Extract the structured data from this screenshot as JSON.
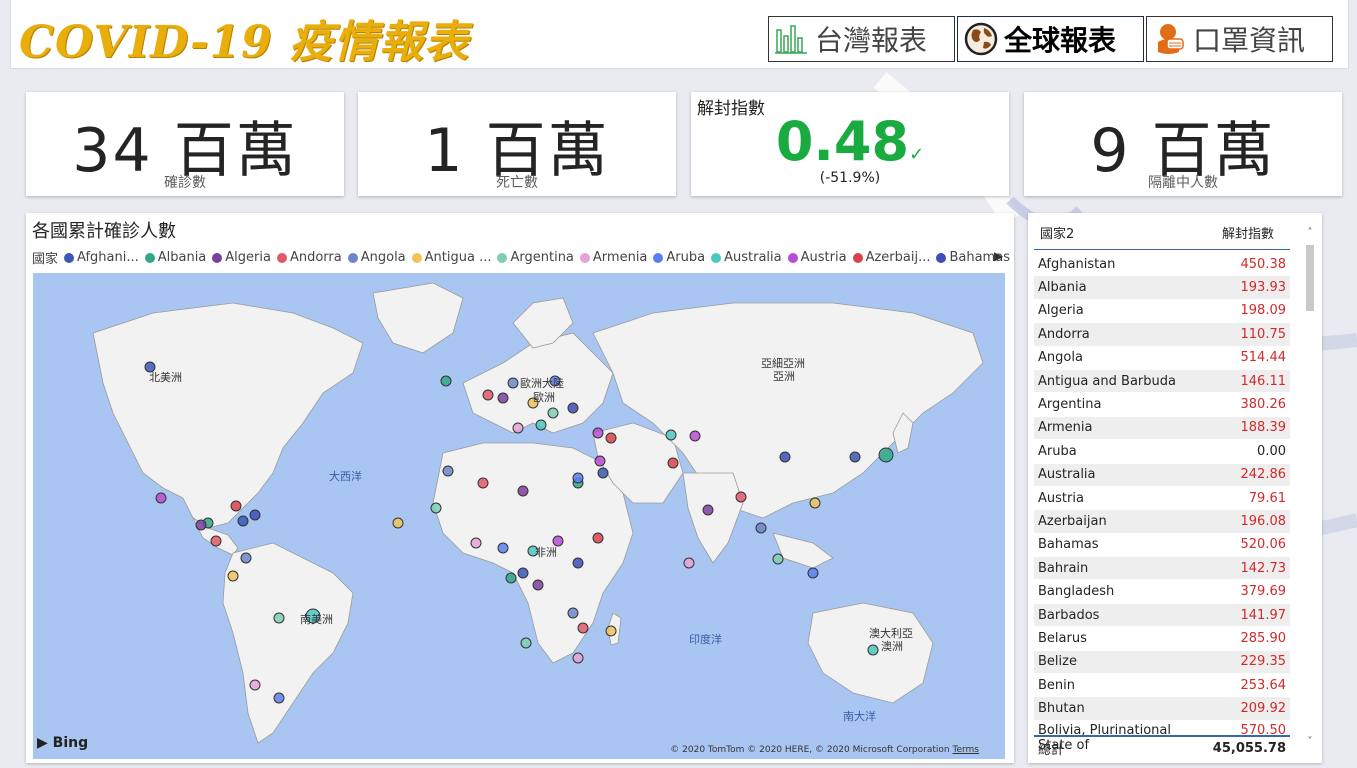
{
  "header": {
    "title": "COVID-19 疫情報表",
    "nav": [
      {
        "label": "台灣報表",
        "icon": "bar-chart-icon",
        "active": false
      },
      {
        "label": "全球報表",
        "icon": "globe-icon",
        "active": true
      },
      {
        "label": "口罩資訊",
        "icon": "mask-icon",
        "active": false
      }
    ]
  },
  "cards": {
    "confirmed": {
      "value": "34 百萬",
      "caption": "確診數"
    },
    "deaths": {
      "value": "1 百萬",
      "caption": "死亡數"
    },
    "reopen": {
      "title": "解封指數",
      "value": "0.48",
      "check": "✓",
      "sub": "(-51.9%)"
    },
    "quarantine": {
      "value": "9 百萬",
      "caption": "隔離中人數"
    }
  },
  "map_panel": {
    "title": "各國累計確診人數",
    "legend_label": "國家",
    "legend": [
      {
        "name": "Afghani...",
        "color": "#3a58b5"
      },
      {
        "name": "Albania",
        "color": "#2fa889"
      },
      {
        "name": "Algeria",
        "color": "#7b3fa0"
      },
      {
        "name": "Andorra",
        "color": "#e0596b"
      },
      {
        "name": "Angola",
        "color": "#6b86c9"
      },
      {
        "name": "Antigua ...",
        "color": "#f0c35a"
      },
      {
        "name": "Argentina",
        "color": "#7fcfb0"
      },
      {
        "name": "Armenia",
        "color": "#e5a3d6"
      },
      {
        "name": "Aruba",
        "color": "#5c7ff0"
      },
      {
        "name": "Australia",
        "color": "#4cc7c0"
      },
      {
        "name": "Austria",
        "color": "#b84cd4"
      },
      {
        "name": "Azerbaij...",
        "color": "#d8434a"
      },
      {
        "name": "Bahamas",
        "color": "#3d4cb8"
      }
    ],
    "regions": {
      "north_america": "北美洲",
      "south_america": "南美洲",
      "europe_1": "歐洲大陸",
      "europe_2": "歐洲",
      "africa": "非洲",
      "asia_1": "亞細亞洲",
      "asia_2": "亞洲",
      "oceania_1": "澳大利亞",
      "oceania_2": "澳洲",
      "atlantic": "大西洋",
      "indian": "印度洋",
      "south_sea": "南大洋"
    },
    "bing": "Bing",
    "copyright": "© 2020 TomTom © 2020 HERE, © 2020 Microsoft Corporation",
    "terms": "Terms"
  },
  "table": {
    "col_country": "國家2",
    "col_index": "解封指數",
    "rows": [
      {
        "country": "Afghanistan",
        "value": "450.38"
      },
      {
        "country": "Albania",
        "value": "193.93"
      },
      {
        "country": "Algeria",
        "value": "198.09"
      },
      {
        "country": "Andorra",
        "value": "110.75"
      },
      {
        "country": "Angola",
        "value": "514.44"
      },
      {
        "country": "Antigua and Barbuda",
        "value": "146.11"
      },
      {
        "country": "Argentina",
        "value": "380.26"
      },
      {
        "country": "Armenia",
        "value": "188.39"
      },
      {
        "country": "Aruba",
        "value": "0.00"
      },
      {
        "country": "Australia",
        "value": "242.86"
      },
      {
        "country": "Austria",
        "value": "79.61"
      },
      {
        "country": "Azerbaijan",
        "value": "196.08"
      },
      {
        "country": "Bahamas",
        "value": "520.06"
      },
      {
        "country": "Bahrain",
        "value": "142.73"
      },
      {
        "country": "Bangladesh",
        "value": "379.69"
      },
      {
        "country": "Barbados",
        "value": "141.97"
      },
      {
        "country": "Belarus",
        "value": "285.90"
      },
      {
        "country": "Belize",
        "value": "229.35"
      },
      {
        "country": "Benin",
        "value": "253.64"
      },
      {
        "country": "Bhutan",
        "value": "209.92"
      },
      {
        "country": "Bolivia, Plurinational State of",
        "value": "570.50"
      }
    ],
    "total_label": "總計",
    "total_value": "45,055.78"
  },
  "colors": {
    "title_gold": "#e9ad0c",
    "kpi_green": "#1aab40",
    "value_red": "#d12a2a",
    "ocean": "#a9c6f2",
    "land": "#f2f2f2"
  }
}
